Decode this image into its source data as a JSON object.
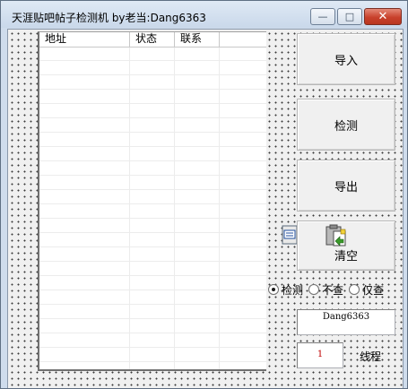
{
  "window": {
    "title": "天涯贴吧帖子检测机 by老当:Dang6363",
    "minimize_glyph": "—",
    "maximize_glyph": "□",
    "close_glyph": "✕"
  },
  "list": {
    "columns": [
      "地址",
      "状态",
      "联系",
      ""
    ]
  },
  "buttons": {
    "import": "导入",
    "check": "检测",
    "export": "导出",
    "clear": "清空",
    "clear_icon": "paste-icon"
  },
  "options": {
    "radio_items": [
      {
        "label": "检测",
        "selected": true
      },
      {
        "label": "不查",
        "selected": false
      },
      {
        "label": "仅查",
        "selected": false
      }
    ]
  },
  "fields": {
    "name_value": "Dang6363",
    "threads_value": "1",
    "threads_label": "线程"
  },
  "colors": {
    "titlebar": "#cfdcec",
    "close_button": "#c8412c",
    "threads_text": "#c00000"
  }
}
